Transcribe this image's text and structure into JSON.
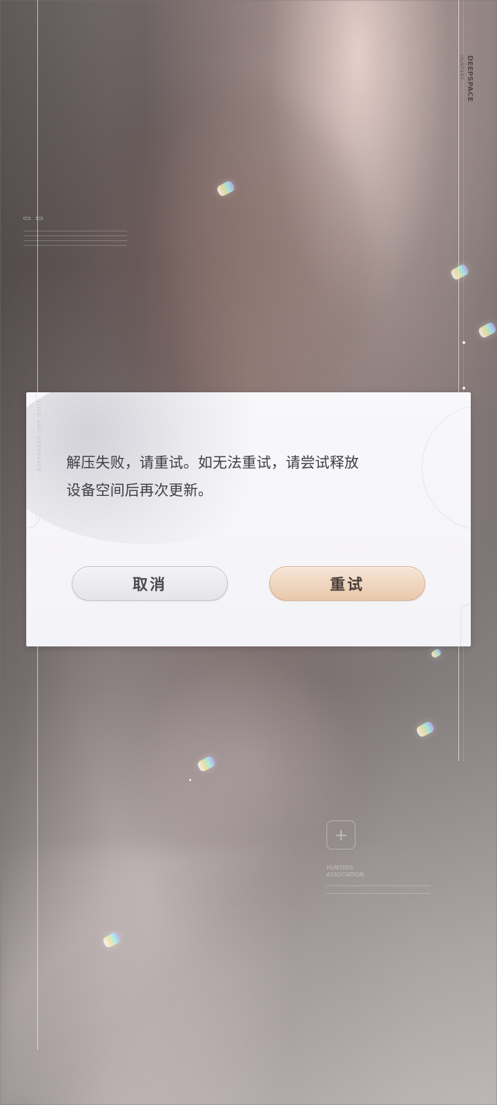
{
  "background": {
    "brand_title": "DEEPSPACE",
    "brand_subtitle": "HUNTERS",
    "left_panel": {
      "header": "",
      "tags": [
        "",
        ""
      ]
    },
    "lower_panel": {
      "label_1": "HUNTERS",
      "label_2": "ASSOCIATION"
    }
  },
  "dialog": {
    "side_text": "LOVE AND DEEPSPACE",
    "message_line_1": "解压失败，请重试。如无法重试，请尝试释放",
    "message_line_2": "设备空间后再次更新。",
    "cancel_label": "取消",
    "retry_label": "重试"
  }
}
